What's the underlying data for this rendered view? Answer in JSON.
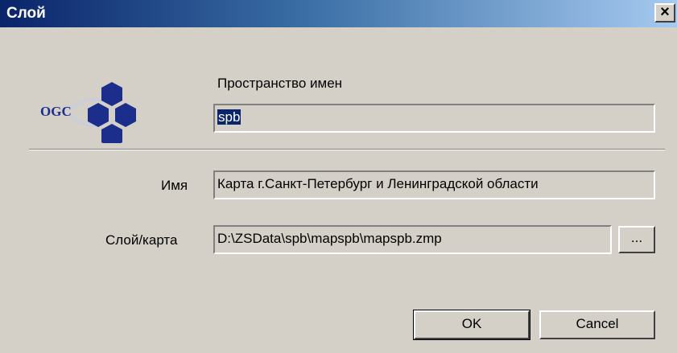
{
  "window": {
    "title": "Слой",
    "close_label": "×"
  },
  "logo": {
    "text": "OGC"
  },
  "namespace": {
    "label": "Пространство имен",
    "value": "spb"
  },
  "name": {
    "label": "Имя",
    "value": "Карта г.Санкт-Петербург и Ленинградской области"
  },
  "layer": {
    "label": "Слой/карта",
    "value": "D:\\ZSData\\spb\\mapspb\\mapspb.zmp",
    "browse_label": "..."
  },
  "buttons": {
    "ok": "OK",
    "cancel": "Cancel"
  },
  "colors": {
    "title_start": "#0a246a",
    "title_end": "#a6caf0",
    "face": "#d4d0c8",
    "hex_blue": "#1c2e8c"
  },
  "icons": [
    "close-icon",
    "ogc-logo-icon"
  ]
}
